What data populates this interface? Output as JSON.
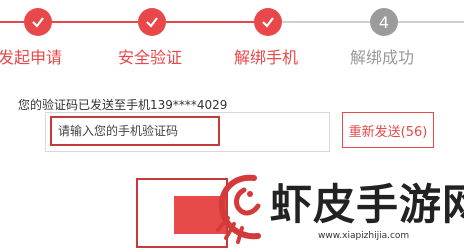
{
  "colors": {
    "accent": "#e8484a",
    "done_step": "#e8484a",
    "pending_step": "#9b9b9b",
    "highlight_border": "#c53a3a"
  },
  "steps": [
    {
      "label": "发起申请",
      "state": "done",
      "icon": "check-icon"
    },
    {
      "label": "安全验证",
      "state": "done",
      "icon": "check-icon"
    },
    {
      "label": "解绑手机",
      "state": "done",
      "icon": "check-icon"
    },
    {
      "label": "解绑成功",
      "state": "pending",
      "number": "4"
    }
  ],
  "verification": {
    "notice": "您的验证码已发送至手机139****4029",
    "input_value": "",
    "input_placeholder": "请输入您的手机验证码",
    "resend_label": "重新发送(56)"
  },
  "submit": {
    "label": ""
  },
  "watermark": {
    "title": "虾皮手游网",
    "url": "www.xiapizhijia.com",
    "logo_icon": "shrimp-logo-icon"
  }
}
